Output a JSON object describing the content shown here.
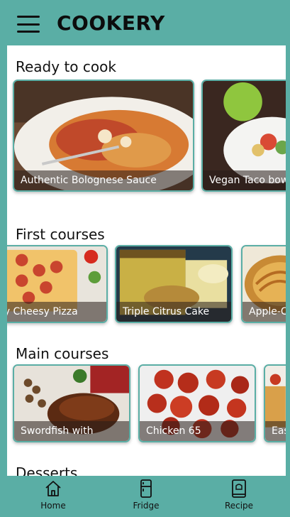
{
  "header": {
    "title": "COOKERY"
  },
  "sections": [
    {
      "title": "Ready to cook",
      "cards": [
        "Authentic Bolognese Sauce",
        "Vegan Taco bowls"
      ]
    },
    {
      "title": "First courses",
      "cards": [
        "Easy Cheesy Pizza",
        "Triple Citrus Cake",
        "Apple-Cinnamon Tart"
      ]
    },
    {
      "title": "Main courses",
      "cards": [
        "Swordfish with",
        "Chicken 65",
        "Easy"
      ]
    },
    {
      "title": "Desserts"
    }
  ],
  "nav": [
    {
      "label": "Home",
      "icon": "home-icon"
    },
    {
      "label": "Fridge",
      "icon": "fridge-icon"
    },
    {
      "label": "Recipe",
      "icon": "recipe-book-icon"
    }
  ],
  "colors": {
    "accent": "#5aaea5",
    "background": "#ffffff",
    "title": "#0c0c0c"
  }
}
